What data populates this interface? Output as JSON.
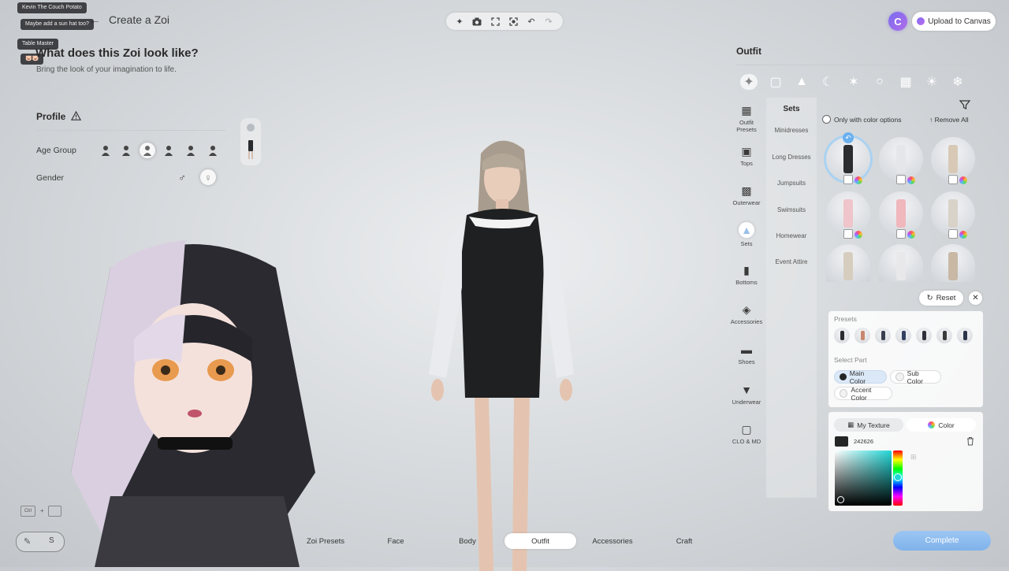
{
  "header": {
    "back_icon": "arrow-left-icon",
    "title": "Create a Zoi"
  },
  "chat": [
    {
      "user": "Kevin The Couch Potato",
      "message": "Maybe add a sun hat too?"
    },
    {
      "user": "Table Master",
      "message": "🐷🐷"
    }
  ],
  "intro": {
    "question": "What does this Zoi look like?",
    "subtitle": "Bring the look of your imagination to life."
  },
  "profile": {
    "title": "Profile",
    "age_label": "Age Group",
    "gender_label": "Gender",
    "age_selected_index": 2,
    "gender_selected": "female"
  },
  "toolbar": {
    "icons": [
      "sparkle-icon",
      "camera-icon",
      "fullscreen-icon",
      "focus-icon",
      "undo-icon",
      "redo-icon"
    ]
  },
  "topright": {
    "logo_letter": "C",
    "upload_label": "Upload to Canvas"
  },
  "outfit": {
    "title": "Outfit",
    "categories": [
      {
        "label": "Outfit Presets",
        "icon": "outfit-presets-icon"
      },
      {
        "label": "Tops",
        "icon": "tshirt-icon"
      },
      {
        "label": "Outerwear",
        "icon": "jacket-icon"
      },
      {
        "label": "Sets",
        "icon": "dress-icon"
      },
      {
        "label": "Bottoms",
        "icon": "pants-icon"
      },
      {
        "label": "Accessories",
        "icon": "accessory-icon"
      },
      {
        "label": "Shoes",
        "icon": "shoe-icon"
      },
      {
        "label": "Underwear",
        "icon": "underwear-icon"
      },
      {
        "label": "CLO & MD",
        "icon": "clo-icon"
      }
    ],
    "selected_category": "Sets",
    "subcategory_header": "Sets",
    "subcategories": [
      "Minidresses",
      "Long Dresses",
      "Jumpsuits",
      "Swimsuits",
      "Homewear",
      "Event Attire"
    ],
    "only_color_label": "Only with color options",
    "remove_all_label": "Remove All",
    "reset_label": "Reset",
    "presets_label": "Presets",
    "select_part_label": "Select Part",
    "parts": [
      "Main Color",
      "Sub Color",
      "Accent Color"
    ],
    "selected_part": "Main Color",
    "texture_tab": "My Texture",
    "color_tab": "Color",
    "hex_value": "242626",
    "selected_color": "#242626"
  },
  "nav": {
    "items": [
      "Zoi Presets",
      "Face",
      "Body",
      "Outfit",
      "Accessories",
      "Craft"
    ],
    "selected": "Outfit",
    "complete_label": "Complete",
    "ctrl_label": "Ctrl"
  }
}
